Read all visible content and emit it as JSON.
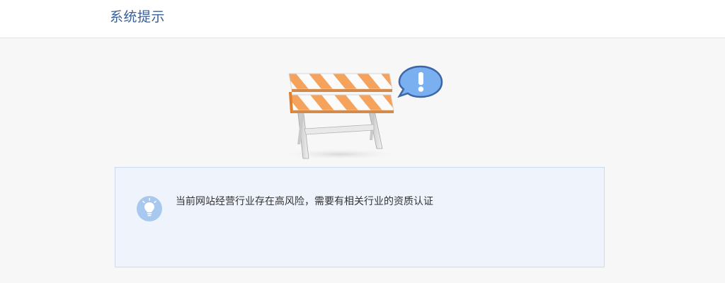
{
  "header": {
    "title": "系统提示"
  },
  "illustration": {
    "icon": "road-barrier-icon",
    "bubble_icon": "exclamation-bubble-icon",
    "stripe_color": "#f4a25c",
    "bubble_color": "#6ea3e8"
  },
  "notice": {
    "icon": "lightbulb-icon",
    "message": "当前网站经营行业存在高风险，需要有相关行业的资质认证",
    "background": "#eff4fc",
    "border": "#cbdaf0"
  }
}
